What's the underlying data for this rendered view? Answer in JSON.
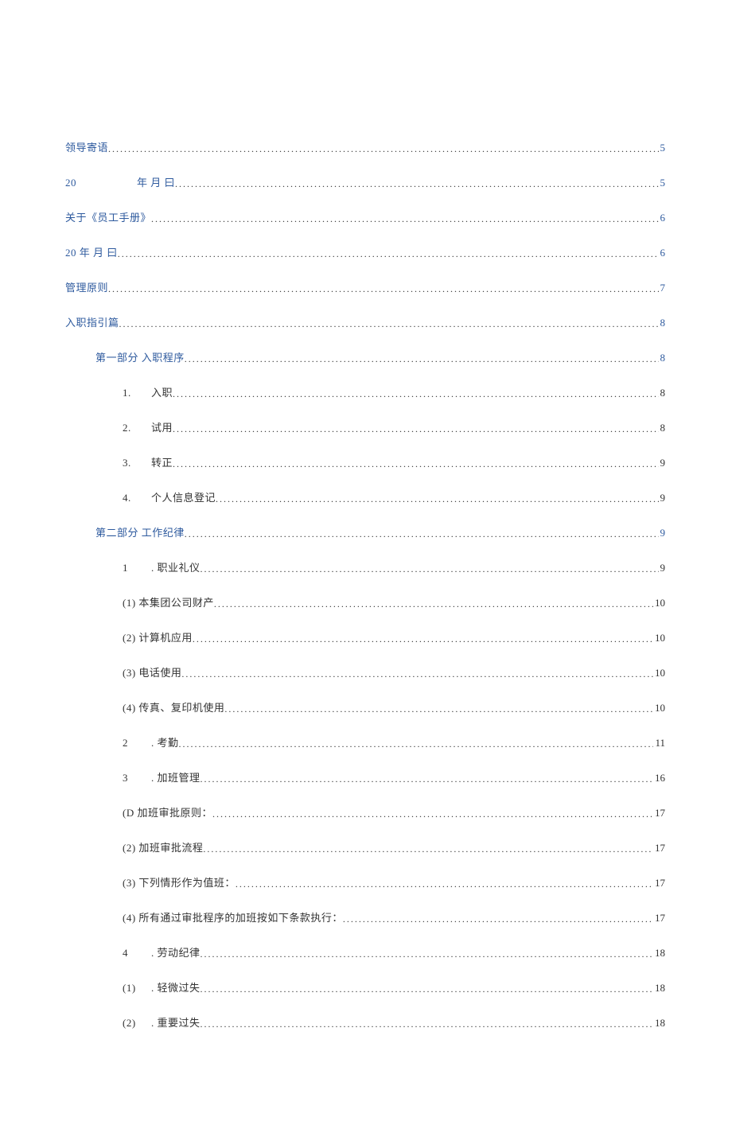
{
  "toc": [
    {
      "label_parts": [
        "领导寄语"
      ],
      "page": "5",
      "indent": 0,
      "blue": true,
      "special20": false
    },
    {
      "label_parts": [
        "20",
        "年 月 曰"
      ],
      "page": "5",
      "indent": 0,
      "blue": true,
      "special20": true
    },
    {
      "label_parts": [
        "关于《员工手册》"
      ],
      "page": "6",
      "indent": 0,
      "blue": true,
      "special20": false
    },
    {
      "label_parts": [
        "20 年 月 曰"
      ],
      "page": "6",
      "indent": 0,
      "blue": true,
      "special20": false
    },
    {
      "label_parts": [
        "管理原则"
      ],
      "page": "7",
      "indent": 0,
      "blue": true,
      "special20": false
    },
    {
      "label_parts": [
        "入职指引篇"
      ],
      "page": "8",
      "indent": 0,
      "blue": true,
      "special20": false
    },
    {
      "label_parts": [
        "第一部分 入职程序"
      ],
      "page": "8",
      "indent": 1,
      "blue": true,
      "special20": false
    },
    {
      "label_parts": [
        "1.",
        "入职"
      ],
      "page": "8",
      "indent": 2,
      "blue": false,
      "special20": false,
      "numgap": true
    },
    {
      "label_parts": [
        "2.",
        "试用"
      ],
      "page": "8",
      "indent": 2,
      "blue": false,
      "special20": false,
      "numgap": true
    },
    {
      "label_parts": [
        "3.",
        "转正"
      ],
      "page": "9",
      "indent": 2,
      "blue": false,
      "special20": false,
      "numgap": true
    },
    {
      "label_parts": [
        "4.",
        "个人信息登记"
      ],
      "page": "9",
      "indent": 2,
      "blue": false,
      "special20": false,
      "numgap": true
    },
    {
      "label_parts": [
        "第二部分 工作纪律"
      ],
      "page": "9",
      "indent": 1,
      "blue": true,
      "special20": false
    },
    {
      "label_parts": [
        "1",
        ". 职业礼仪"
      ],
      "page": "9",
      "indent": 2,
      "blue": false,
      "special20": false,
      "numgap": true
    },
    {
      "label_parts": [
        "(1) 本集团公司财产"
      ],
      "page": "10",
      "indent": 2,
      "blue": false,
      "special20": false
    },
    {
      "label_parts": [
        "(2) 计算机应用"
      ],
      "page": "10",
      "indent": 2,
      "blue": false,
      "special20": false
    },
    {
      "label_parts": [
        "(3) 电话使用"
      ],
      "page": "10",
      "indent": 2,
      "blue": false,
      "special20": false
    },
    {
      "label_parts": [
        "(4) 传真、复印机使用"
      ],
      "page": "10",
      "indent": 2,
      "blue": false,
      "special20": false
    },
    {
      "label_parts": [
        "2",
        ". 考勤"
      ],
      "page": "11",
      "indent": 2,
      "blue": false,
      "special20": false,
      "numgap": true
    },
    {
      "label_parts": [
        "3",
        ". 加班管理"
      ],
      "page": "16",
      "indent": 2,
      "blue": false,
      "special20": false,
      "numgap": true
    },
    {
      "label_parts": [
        "(D 加班审批原则："
      ],
      "page": "17",
      "indent": 2,
      "blue": false,
      "special20": false
    },
    {
      "label_parts": [
        "(2) 加班审批流程"
      ],
      "page": "17",
      "indent": 2,
      "blue": false,
      "special20": false
    },
    {
      "label_parts": [
        "(3) 下列情形作为值班："
      ],
      "page": "17",
      "indent": 2,
      "blue": false,
      "special20": false
    },
    {
      "label_parts": [
        "(4) 所有通过审批程序的加班按如下条款执行："
      ],
      "page": "17",
      "indent": 2,
      "blue": false,
      "special20": false
    },
    {
      "label_parts": [
        "4",
        ". 劳动纪律"
      ],
      "page": "18",
      "indent": 2,
      "blue": false,
      "special20": false,
      "numgap": true
    },
    {
      "label_parts": [
        "(1)",
        ". 轻微过失"
      ],
      "page": "18",
      "indent": 2,
      "blue": false,
      "special20": false,
      "numgap": true
    },
    {
      "label_parts": [
        "(2)",
        ". 重要过失"
      ],
      "page": "18",
      "indent": 2,
      "blue": false,
      "special20": false,
      "numgap": true
    }
  ]
}
